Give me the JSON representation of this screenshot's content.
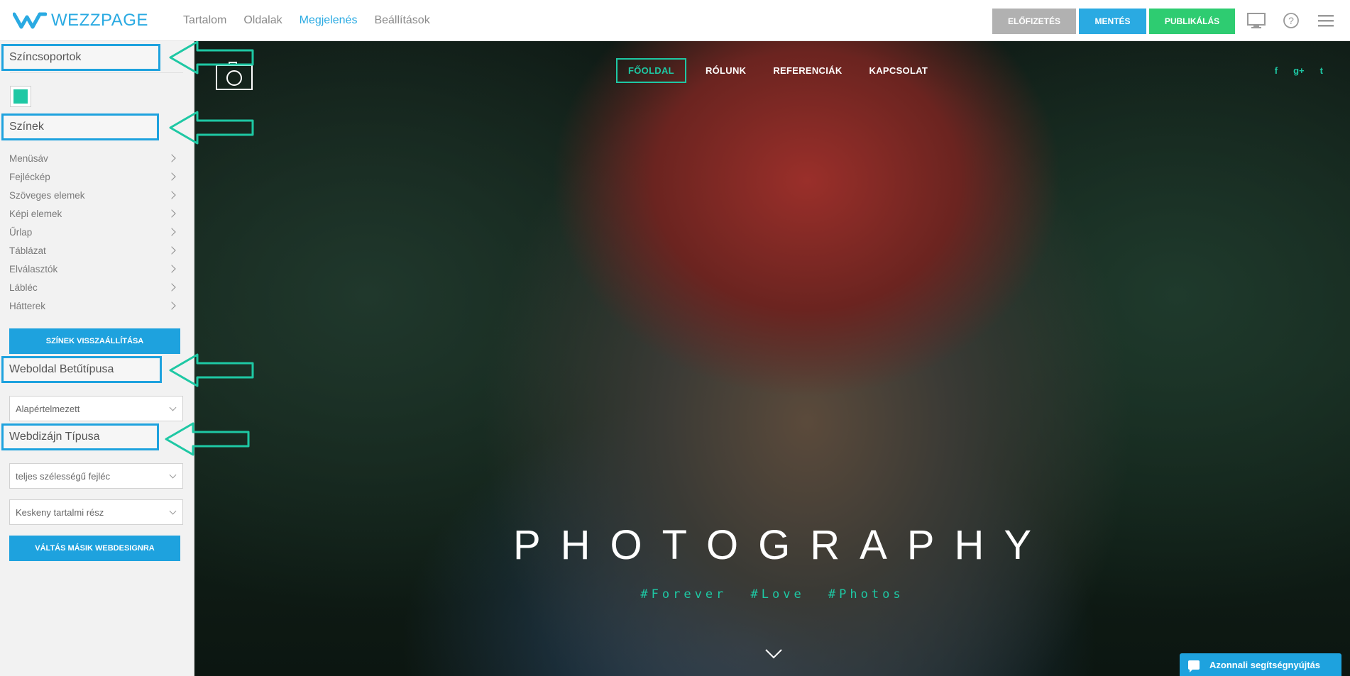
{
  "brand": {
    "name": "WEZZPAGE",
    "color": "#2aaae2"
  },
  "nav": {
    "items": [
      {
        "label": "Tartalom"
      },
      {
        "label": "Oldalak"
      },
      {
        "label": "Megjelenés",
        "active": true
      },
      {
        "label": "Beállítások"
      }
    ]
  },
  "toolbar": {
    "preview_label": "ELŐFIZETÉS",
    "save_label": "MENTÉS",
    "publish_label": "PUBLIKÁLÁS",
    "icons": [
      "monitor-icon",
      "help-icon",
      "menu-icon"
    ]
  },
  "sidebar": {
    "color_groups_title": "Színcsoportok",
    "swatch_color": "#1ec8a4",
    "colors_title": "Színek",
    "color_items": [
      {
        "label": "Menüsáv"
      },
      {
        "label": "Fejléckép"
      },
      {
        "label": "Szöveges elemek"
      },
      {
        "label": "Képi elemek"
      },
      {
        "label": "Űrlap"
      },
      {
        "label": "Táblázat"
      },
      {
        "label": "Elválasztók"
      },
      {
        "label": "Lábléc"
      },
      {
        "label": "Hátterek"
      }
    ],
    "reset_colors_label": "SZÍNEK VISSZAÁLLÍTÁSA",
    "font_title": "Weboldal Betűtípusa",
    "font_value": "Alapértelmezett",
    "design_title": "Webdizájn Típusa",
    "header_type_value": "teljes szélességű fejléc",
    "content_type_value": "Keskeny tartalmi rész",
    "switch_design_label": "VÁLTÁS MÁSIK WEBDESIGNRA"
  },
  "site": {
    "nav": [
      {
        "label": "FŐOLDAL",
        "active": true
      },
      {
        "label": "RÓLUNK"
      },
      {
        "label": "REFERENCIÁK"
      },
      {
        "label": "KAPCSOLAT"
      }
    ],
    "social": [
      {
        "glyph": "f",
        "name": "facebook-icon"
      },
      {
        "glyph": "g+",
        "name": "google-plus-icon"
      },
      {
        "glyph": "t",
        "name": "twitter-icon"
      }
    ],
    "hero_title": "PHOTOGRAPHY",
    "hero_tags": "#Forever #Love #Photos",
    "accent": "#1ec8a4"
  },
  "help": {
    "label": "Azonnali segítségnyújtás"
  },
  "annotation_color": "#1ec8a4",
  "highlight_color": "#1ea2de"
}
